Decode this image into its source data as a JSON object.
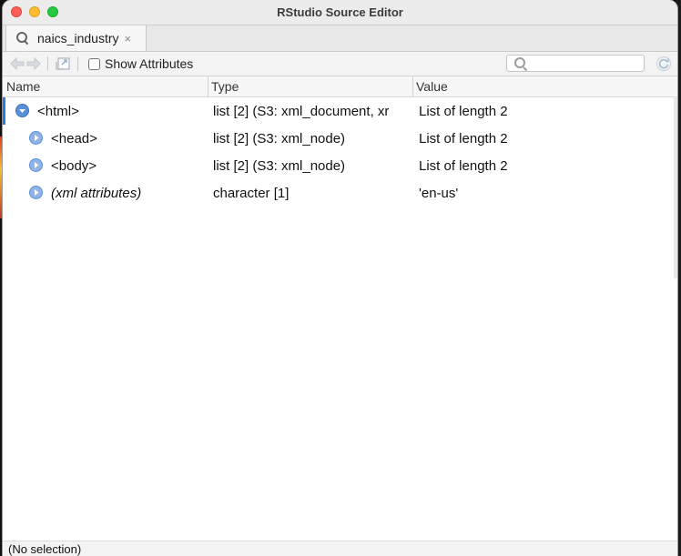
{
  "window": {
    "title": "RStudio Source Editor"
  },
  "tab": {
    "label": "naics_industry",
    "close_glyph": "×"
  },
  "toolbar": {
    "show_attributes_label": "Show Attributes",
    "search_placeholder": ""
  },
  "columns": {
    "name": "Name",
    "type": "Type",
    "value": "Value"
  },
  "rows": [
    {
      "name": "<html>",
      "type": "list [2] (S3: xml_document, xr",
      "value": "List of length 2",
      "expanded": true,
      "italic": false
    },
    {
      "name": "<head>",
      "type": "list [2] (S3: xml_node)",
      "value": "List of length 2",
      "expanded": false,
      "italic": false
    },
    {
      "name": "<body>",
      "type": "list [2] (S3: xml_node)",
      "value": "List of length 2",
      "expanded": false,
      "italic": false
    },
    {
      "name": "(xml attributes)",
      "type": "character [1]",
      "value": "'en-us'",
      "expanded": false,
      "italic": true
    }
  ],
  "status": {
    "text": "(No selection)"
  },
  "colors": {
    "accent": "#2b7bd6",
    "expander": "#5b8fd8"
  },
  "icons": [
    "search-icon",
    "close-icon",
    "back-arrow-icon",
    "forward-arrow-icon",
    "popout-icon",
    "refresh-icon",
    "expand-down-icon",
    "expand-right-icon"
  ]
}
